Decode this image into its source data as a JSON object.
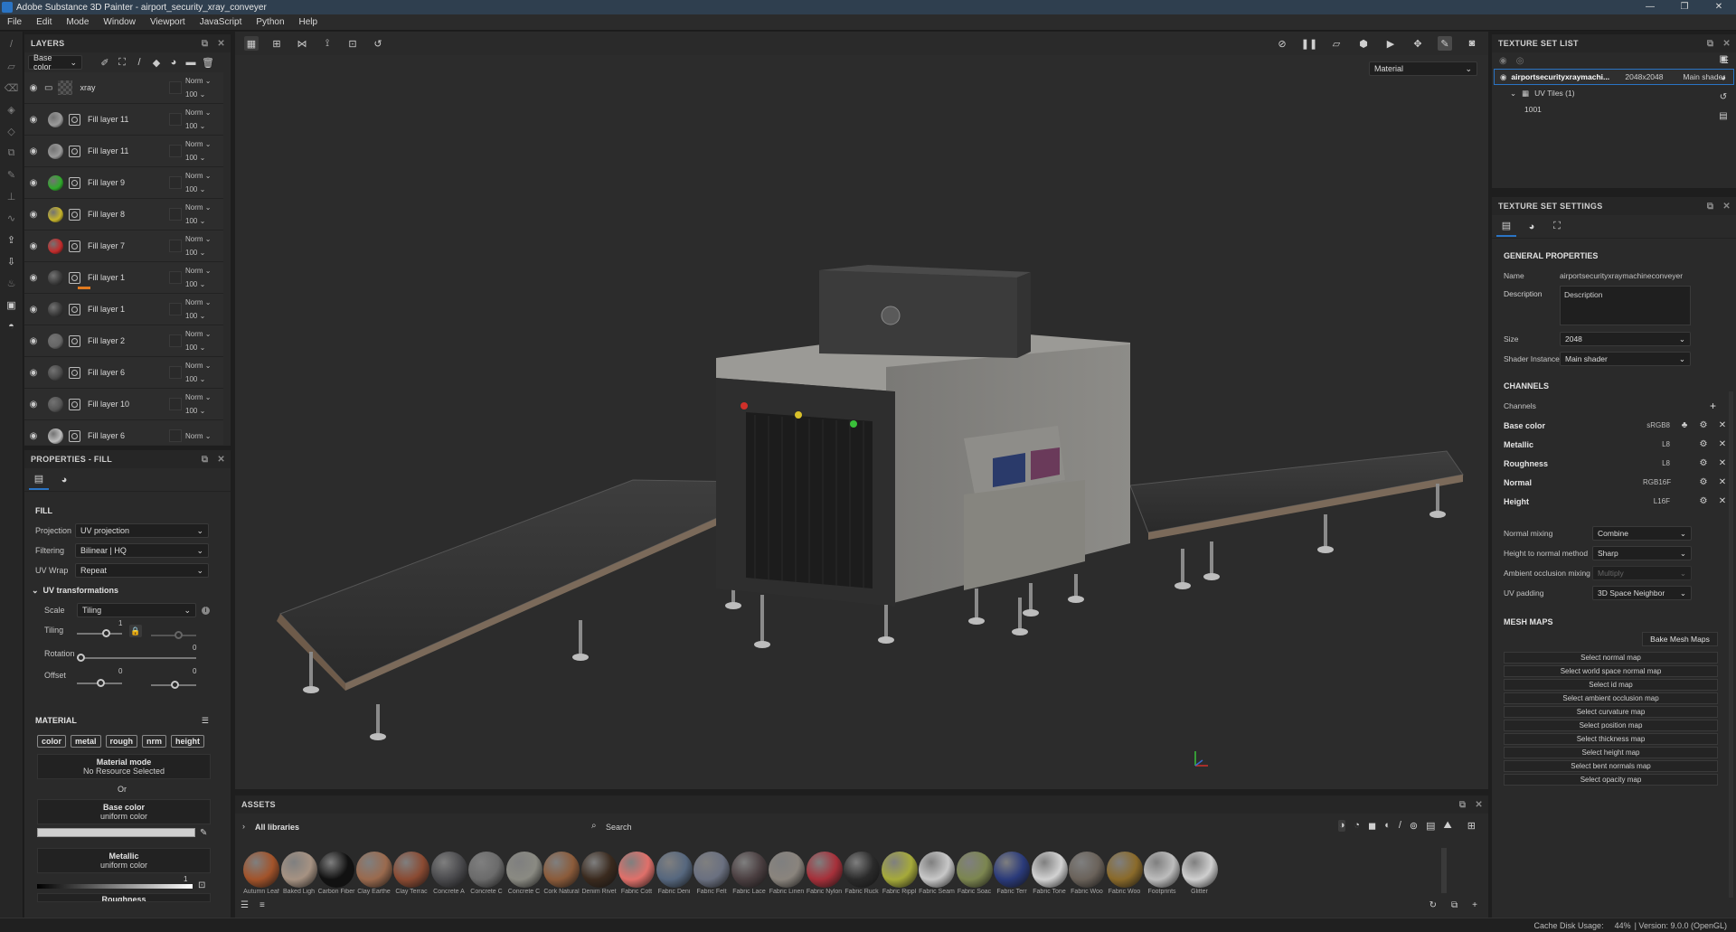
{
  "window": {
    "title": "Adobe Substance 3D Painter - airport_security_xray_conveyer",
    "controls": [
      "—",
      "❐",
      "✕"
    ]
  },
  "menu": [
    "File",
    "Edit",
    "Mode",
    "Window",
    "Viewport",
    "JavaScript",
    "Python",
    "Help"
  ],
  "layers": {
    "title": "LAYERS",
    "channel": "Base color",
    "folder": {
      "name": "xray",
      "blend": "Norm",
      "opacity": "100"
    },
    "items": [
      {
        "name": "Fill layer 11",
        "blend": "Norm",
        "opacity": "100",
        "color": "#9a9a9a"
      },
      {
        "name": "Fill layer 11",
        "blend": "Norm",
        "opacity": "100",
        "color": "#9a9a9a"
      },
      {
        "name": "Fill layer 9",
        "blend": "Norm",
        "opacity": "100",
        "color": "#2faa2a"
      },
      {
        "name": "Fill layer 8",
        "blend": "Norm",
        "opacity": "100",
        "color": "#c6b42a"
      },
      {
        "name": "Fill layer 7",
        "blend": "Norm",
        "opacity": "100",
        "color": "#c22a2a"
      },
      {
        "name": "Fill layer 1",
        "blend": "Norm",
        "opacity": "100",
        "color": "#3a3a3a"
      },
      {
        "name": "Fill layer 1",
        "blend": "Norm",
        "opacity": "100",
        "color": "#3a3a3a"
      },
      {
        "name": "Fill layer 2",
        "blend": "Norm",
        "opacity": "100",
        "color": "#666666"
      },
      {
        "name": "Fill layer 6",
        "blend": "Norm",
        "opacity": "100",
        "color": "#4a4a4a"
      },
      {
        "name": "Fill layer 10",
        "blend": "Norm",
        "opacity": "100",
        "color": "#555555"
      },
      {
        "name": "Fill layer 6",
        "blend": "Norm",
        "opacity": "",
        "color": "#bdbdbd"
      }
    ]
  },
  "properties": {
    "title": "PROPERTIES - FILL",
    "fill_section": "FILL",
    "projection_label": "Projection",
    "projection": "UV projection",
    "filtering_label": "Filtering",
    "filtering": "Bilinear | HQ",
    "uvwrap_label": "UV Wrap",
    "uvwrap": "Repeat",
    "uvt_label": "UV transformations",
    "scale_label": "Scale",
    "scale": "Tiling",
    "tiling_label": "Tiling",
    "tiling_value": "1",
    "rotation_label": "Rotation",
    "rotation_value": "0",
    "offset_label": "Offset",
    "offset_x": "0",
    "offset_y": "0",
    "material_section": "MATERIAL",
    "chips": [
      "color",
      "metal",
      "rough",
      "nrm",
      "height"
    ],
    "material_mode_title": "Material mode",
    "material_mode_value": "No Resource Selected",
    "or_label": "Or",
    "base_color_title": "Base color",
    "base_color_sub": "uniform color",
    "metallic_title": "Metallic",
    "metallic_sub": "uniform color",
    "metallic_value": "1",
    "roughness_title": "Roughness"
  },
  "viewport": {
    "material_mode": "Material"
  },
  "assets": {
    "title": "ASSETS",
    "library": "All libraries",
    "search_placeholder": "Search",
    "items": [
      {
        "name": "Autumn Leaf",
        "color": "#a2532a"
      },
      {
        "name": "Baked Ligh",
        "color": "#a69282"
      },
      {
        "name": "Carbon Fiber",
        "color": "#111111"
      },
      {
        "name": "Clay Earthe",
        "color": "#9a6a4e"
      },
      {
        "name": "Clay Terrac",
        "color": "#8a4a32"
      },
      {
        "name": "Concrete A",
        "color": "#4a4a4d"
      },
      {
        "name": "Concrete C",
        "color": "#6b6b6b"
      },
      {
        "name": "Concrete C",
        "color": "#8a8a82"
      },
      {
        "name": "Cork Natural",
        "color": "#8b5b3a"
      },
      {
        "name": "Denim Rivet",
        "color": "#3a2a1e"
      },
      {
        "name": "Fabric Cott",
        "color": "#e0706a"
      },
      {
        "name": "Fabric Deni",
        "color": "#56677e"
      },
      {
        "name": "Fabric Felt",
        "color": "#6a7080"
      },
      {
        "name": "Fabric Lace",
        "color": "#4a3e40"
      },
      {
        "name": "Fabric Linen",
        "color": "#8a847d"
      },
      {
        "name": "Fabric Nylon",
        "color": "#a6303a"
      },
      {
        "name": "Fabric Ruck",
        "color": "#2a2a2a"
      },
      {
        "name": "Fabric Rippl",
        "color": "#a6aa3a"
      },
      {
        "name": "Fabric Seam",
        "color": "#c8c8c8"
      },
      {
        "name": "Fabric Soac",
        "color": "#7c8650"
      },
      {
        "name": "Fabric Terr",
        "color": "#2a3a7a"
      },
      {
        "name": "Fabric Tone",
        "color": "#d2d2d2"
      },
      {
        "name": "Fabric Woo",
        "color": "#6a625a"
      },
      {
        "name": "Fabric Woo",
        "color": "#8a6a2a"
      },
      {
        "name": "Footprints",
        "color": "#bdbdbd"
      },
      {
        "name": "Glitter",
        "color": "#cfcfcf"
      }
    ]
  },
  "texture_set_list": {
    "title": "TEXTURE SET LIST",
    "set_name": "airportsecurityxraymachi...",
    "set_size": "2048x2048",
    "set_shader": "Main shader",
    "uv_tiles": "UV Tiles (1)",
    "tile": "1001"
  },
  "texture_set_settings": {
    "title": "TEXTURE SET SETTINGS",
    "general_section": "GENERAL PROPERTIES",
    "name_label": "Name",
    "name_value": "airportsecurityxraymachineconveyer",
    "description_label": "Description",
    "description_value": "Description",
    "size_label": "Size",
    "size_value": "2048",
    "shader_label": "Shader Instance",
    "shader_value": "Main shader",
    "channels_section": "CHANNELS",
    "channels_label": "Channels",
    "channels": [
      {
        "name": "Base color",
        "format": "sRGB8"
      },
      {
        "name": "Metallic",
        "format": "L8"
      },
      {
        "name": "Roughness",
        "format": "L8"
      },
      {
        "name": "Normal",
        "format": "RGB16F"
      },
      {
        "name": "Height",
        "format": "L16F"
      }
    ],
    "normal_mixing_label": "Normal mixing",
    "normal_mixing": "Combine",
    "h2n_label": "Height to normal method",
    "h2n": "Sharp",
    "ao_mixing_label": "Ambient occlusion mixing",
    "ao_mixing": "Multiply",
    "uv_padding_label": "UV padding",
    "uv_padding": "3D Space Neighbor",
    "mesh_maps_section": "MESH MAPS",
    "bake_button": "Bake Mesh Maps",
    "mesh_maps": [
      "Select normal map",
      "Select world space normal map",
      "Select id map",
      "Select ambient occlusion map",
      "Select curvature map",
      "Select position map",
      "Select thickness map",
      "Select height map",
      "Select bent normals map",
      "Select opacity map"
    ]
  },
  "status": {
    "cache": "Cache Disk Usage:",
    "cache_value": "44%",
    "version": "| Version: 9.0.0 (OpenGL)"
  }
}
